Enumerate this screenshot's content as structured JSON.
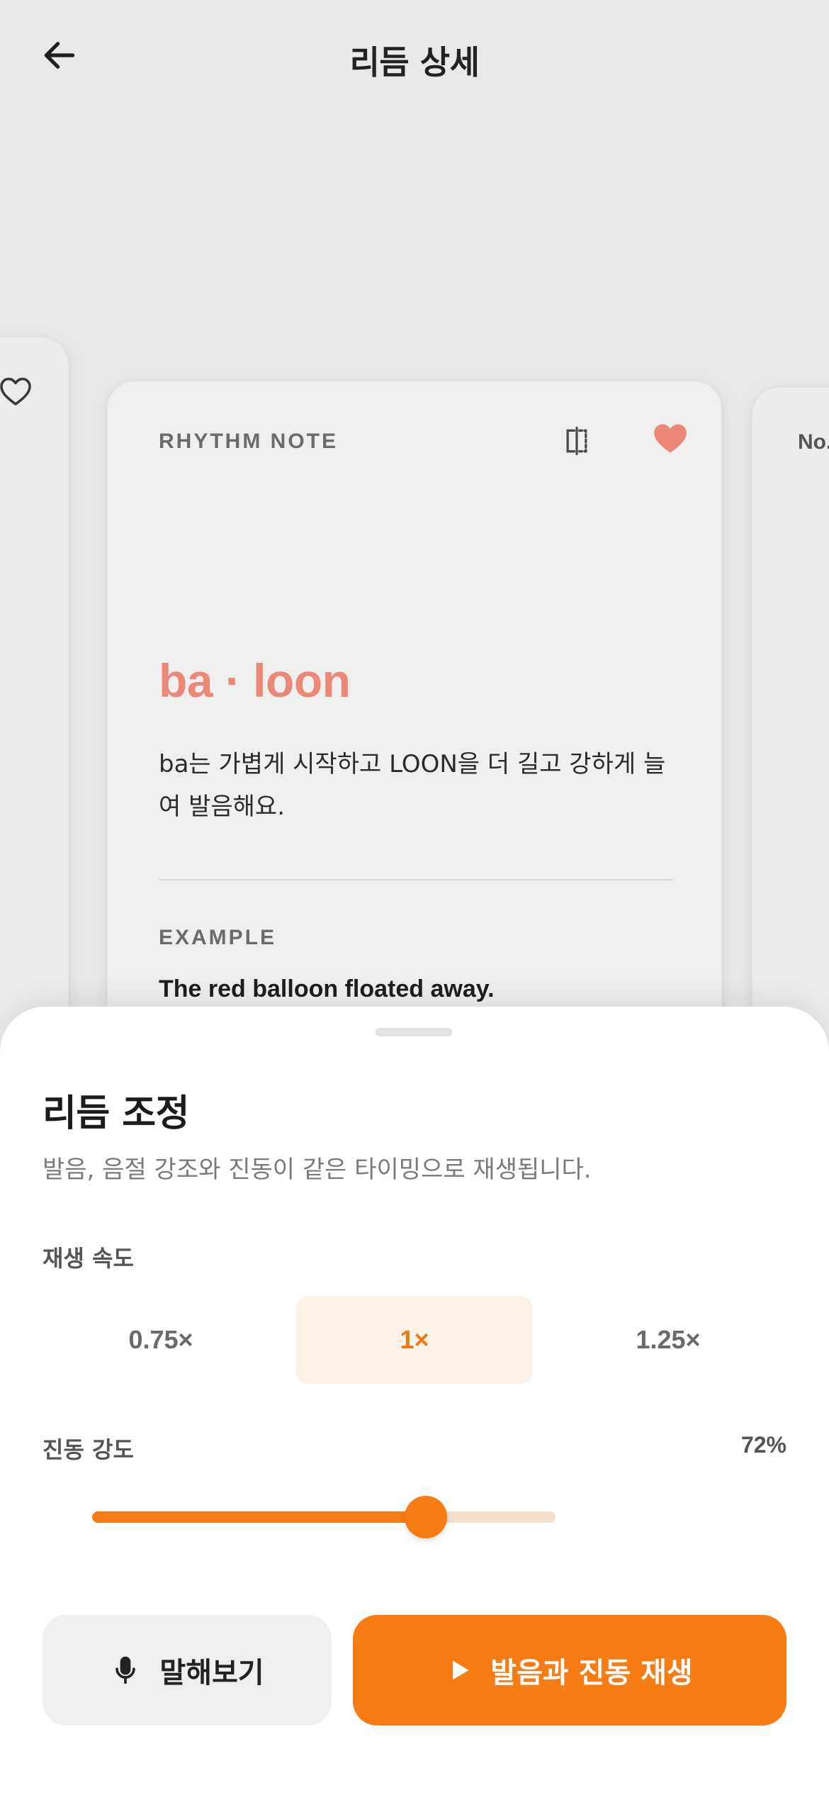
{
  "header": {
    "title": "리듬 상세",
    "back_icon": "arrow-left-icon"
  },
  "cards": {
    "right_label": "No.",
    "main": {
      "note_label": "RHYTHM NOTE",
      "syllables": "ba · loon",
      "description": "ba는 가볍게 시작하고 LOON을 더 길고 강하게 늘여 발음해요.",
      "example_label": "EXAMPLE",
      "example_text": "The red balloon floated away.",
      "favorited": true
    }
  },
  "sheet": {
    "title": "리듬 조정",
    "subtitle": "발음, 음절 강조와 진동이 같은 타이밍으로 재생됩니다.",
    "speed": {
      "label": "재생 속도",
      "options": [
        "0.75×",
        "1×",
        "1.25×"
      ],
      "selected": "1×"
    },
    "vibration": {
      "label": "진동 강도",
      "value_text": "72%",
      "value": 0.72
    },
    "buttons": {
      "speak": "말해보기",
      "play": "발음과 진동 재생"
    }
  },
  "colors": {
    "accent": "#f77c14",
    "accent_soft": "#fdf2e7",
    "syllable": "#ec8878",
    "heart": "#ec8878",
    "background": "#e9e9e8"
  }
}
